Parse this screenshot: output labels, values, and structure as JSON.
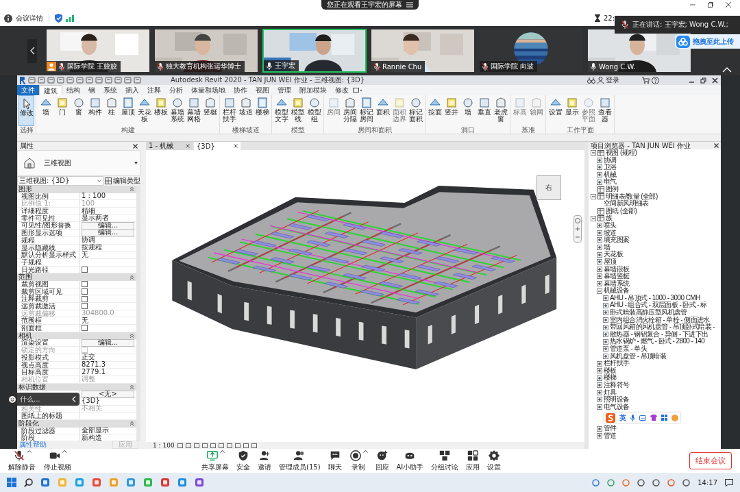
{
  "meeting": {
    "banner": "您正在观看王宇宏的屏幕",
    "details": "会议详情",
    "timer": "22:",
    "speaking": "正在讲话:  王宇宏; Wong C.W.;",
    "upload": "拖拽至此上传"
  },
  "participants": [
    {
      "name": "国际学院 王姣姣",
      "muted": true,
      "speaking": false,
      "host": true,
      "kind": "video"
    },
    {
      "name": "独大教育机构张运华博士",
      "muted": true,
      "speaking": false,
      "host": false,
      "kind": "video"
    },
    {
      "name": "王宇宏",
      "muted": false,
      "speaking": true,
      "host": false,
      "kind": "video"
    },
    {
      "name": "Rannie Chu",
      "muted": true,
      "speaking": false,
      "host": false,
      "kind": "video"
    },
    {
      "name": "国际学院 向波",
      "muted": true,
      "speaking": false,
      "host": false,
      "kind": "avatar"
    },
    {
      "name": "Wong C.W.",
      "muted": false,
      "speaking": false,
      "host": false,
      "kind": "video"
    }
  ],
  "revit": {
    "title": "Autodesk Revit 2020 - TAN JUN WEI 作业 - 三维视图: {3D}",
    "login": "登录",
    "tabs": [
      {
        "label": "文件",
        "kind": "file",
        "selected": false
      },
      {
        "label": "建筑",
        "kind": "tab",
        "selected": true
      },
      {
        "label": "结构",
        "kind": "tab",
        "selected": false
      },
      {
        "label": "钢",
        "kind": "tab",
        "selected": false
      },
      {
        "label": "系统",
        "kind": "tab",
        "selected": false
      },
      {
        "label": "插入",
        "kind": "tab",
        "selected": false
      },
      {
        "label": "注释",
        "kind": "tab",
        "selected": false
      },
      {
        "label": "分析",
        "kind": "tab",
        "selected": false
      },
      {
        "label": "体量和场地",
        "kind": "tab",
        "selected": false
      },
      {
        "label": "协作",
        "kind": "tab",
        "selected": false
      },
      {
        "label": "视图",
        "kind": "tab",
        "selected": false
      },
      {
        "label": "管理",
        "kind": "tab",
        "selected": false
      },
      {
        "label": "附加模块",
        "kind": "tab",
        "selected": false
      },
      {
        "label": "修改",
        "kind": "tab",
        "selected": false
      }
    ],
    "panels": [
      {
        "label": "选择",
        "tools": [
          {
            "label": "修改",
            "selected": true,
            "disabled": false
          }
        ]
      },
      {
        "label": "构建",
        "tools": [
          {
            "label": "墙",
            "selected": false,
            "disabled": false
          },
          {
            "label": "门",
            "selected": false,
            "disabled": false
          },
          {
            "label": "窗",
            "selected": false,
            "disabled": false
          },
          {
            "label": "构件",
            "selected": false,
            "disabled": false
          },
          {
            "label": "柱",
            "selected": false,
            "disabled": false
          },
          {
            "label": "屋顶",
            "selected": false,
            "disabled": false
          },
          {
            "label": "天花板",
            "selected": false,
            "disabled": false
          },
          {
            "label": "楼板",
            "selected": false,
            "disabled": false
          },
          {
            "label": "幕墙系统",
            "selected": false,
            "disabled": false
          },
          {
            "label": "幕墙网格",
            "selected": false,
            "disabled": false
          },
          {
            "label": "竖梃",
            "selected": false,
            "disabled": false
          }
        ]
      },
      {
        "label": "楼梯坡道",
        "tools": [
          {
            "label": "栏杆扶手",
            "selected": false,
            "disabled": false
          },
          {
            "label": "坡道",
            "selected": false,
            "disabled": false
          },
          {
            "label": "楼梯",
            "selected": false,
            "disabled": false
          }
        ]
      },
      {
        "label": "模型",
        "tools": [
          {
            "label": "模型文字",
            "selected": false,
            "disabled": false
          },
          {
            "label": "模型线",
            "selected": false,
            "disabled": false
          },
          {
            "label": "模型组",
            "selected": false,
            "disabled": false
          }
        ]
      },
      {
        "label": "房间和面积",
        "tools": [
          {
            "label": "房间",
            "selected": false,
            "disabled": true
          },
          {
            "label": "房间分隔",
            "selected": false,
            "disabled": false
          },
          {
            "label": "标记房间",
            "selected": false,
            "disabled": false
          },
          {
            "label": "面积",
            "selected": false,
            "disabled": false
          },
          {
            "label": "面积边界",
            "selected": false,
            "disabled": true
          },
          {
            "label": "标记面积",
            "selected": false,
            "disabled": false
          }
        ]
      },
      {
        "label": "洞口",
        "tools": [
          {
            "label": "按面",
            "selected": false,
            "disabled": false
          },
          {
            "label": "竖井",
            "selected": false,
            "disabled": false
          },
          {
            "label": "墙",
            "selected": false,
            "disabled": false
          },
          {
            "label": "垂直",
            "selected": false,
            "disabled": false
          },
          {
            "label": "老虎窗",
            "selected": false,
            "disabled": false
          }
        ]
      },
      {
        "label": "基准",
        "tools": [
          {
            "label": "标高",
            "selected": false,
            "disabled": true
          },
          {
            "label": "轴网",
            "selected": false,
            "disabled": true
          }
        ]
      },
      {
        "label": "工作平面",
        "tools": [
          {
            "label": "设置",
            "selected": false,
            "disabled": false
          },
          {
            "label": "显示",
            "selected": false,
            "disabled": false
          },
          {
            "label": "参照平面",
            "selected": false,
            "disabled": true
          },
          {
            "label": "查看器",
            "selected": false,
            "disabled": false
          }
        ]
      }
    ]
  },
  "properties": {
    "title": "属性",
    "type_name": "三维视图",
    "instance": "三维视图: {3D}",
    "edit_type": "编辑类型",
    "help": "属性帮助",
    "apply": "应用",
    "overlay": "什么...",
    "groups": [
      {
        "name": "图形",
        "rows": [
          {
            "label": "视图比例",
            "kind": "text",
            "value": "1 : 100",
            "disabled": false
          },
          {
            "label": "比例值 1:",
            "kind": "text",
            "value": "100",
            "disabled": true
          },
          {
            "label": "详细程度",
            "kind": "text",
            "value": "精细",
            "disabled": false
          },
          {
            "label": "零件可见性",
            "kind": "text",
            "value": "显示两者",
            "disabled": false
          },
          {
            "label": "可见性/图形替换",
            "kind": "button",
            "value": "编辑...",
            "disabled": false
          },
          {
            "label": "图形显示选项",
            "kind": "button",
            "value": "编辑...",
            "disabled": false
          },
          {
            "label": "规程",
            "kind": "text",
            "value": "协调",
            "disabled": false
          },
          {
            "label": "显示隐藏线",
            "kind": "text",
            "value": "按规程",
            "disabled": false
          },
          {
            "label": "默认分析显示样式",
            "kind": "text",
            "value": "无",
            "disabled": false
          },
          {
            "label": "子规程",
            "kind": "text",
            "disabled": false
          },
          {
            "label": "日光路径",
            "kind": "checkbox",
            "checked": false,
            "disabled": false
          }
        ]
      },
      {
        "name": "范围",
        "rows": [
          {
            "label": "裁剪视图",
            "kind": "checkbox",
            "checked": false,
            "disabled": false
          },
          {
            "label": "裁剪区域可见",
            "kind": "checkbox",
            "checked": false,
            "disabled": false
          },
          {
            "label": "注释裁剪",
            "kind": "checkbox",
            "checked": false,
            "disabled": false
          },
          {
            "label": "远剪裁激活",
            "kind": "checkbox",
            "checked": false,
            "disabled": false
          },
          {
            "label": "远剪裁偏移",
            "kind": "text",
            "value": "304800.0",
            "disabled": true
          },
          {
            "label": "范围框",
            "kind": "text",
            "value": "无",
            "disabled": false
          },
          {
            "label": "剖面框",
            "kind": "checkbox",
            "checked": false,
            "disabled": false
          }
        ]
      },
      {
        "name": "相机",
        "rows": [
          {
            "label": "渲染设置",
            "kind": "button",
            "value": "编辑...",
            "disabled": false
          },
          {
            "label": "锁定的方向",
            "kind": "checkbox",
            "checked": false,
            "disabled": true
          },
          {
            "label": "投影模式",
            "kind": "text",
            "value": "正交",
            "disabled": false
          },
          {
            "label": "视点高度",
            "kind": "text",
            "value": "8271.3",
            "disabled": false
          },
          {
            "label": "目标高度",
            "kind": "text",
            "value": "2779.1",
            "disabled": false
          },
          {
            "label": "相机位置",
            "kind": "text",
            "value": "调整",
            "disabled": true
          }
        ]
      },
      {
        "name": "标识数据",
        "rows": [
          {
            "kind": "button",
            "value": "<无>",
            "disabled": false
          },
          {
            "kind": "text",
            "value": "{3D}",
            "disabled": false
          },
          {
            "label": "相关性",
            "kind": "text",
            "value": "不相关",
            "disabled": true
          },
          {
            "label": "图纸上的标题",
            "kind": "text",
            "disabled": false
          }
        ]
      },
      {
        "name": "阶段化",
        "rows": [
          {
            "label": "阶段过滤器",
            "kind": "text",
            "value": "全部显示",
            "disabled": false
          },
          {
            "label": "阶段",
            "kind": "text",
            "value": "新构造",
            "disabled": false
          }
        ]
      }
    ]
  },
  "view": {
    "tabs": [
      {
        "label": "1 - 机械",
        "selected": false
      },
      {
        "label": "{3D}",
        "selected": true
      }
    ],
    "cube": "右",
    "scale": "1 : 100"
  },
  "browser": {
    "title": "项目浏览器 - TAN JUN WEI 作业",
    "tree": [
      {
        "label": "视图 (规程)",
        "expanded": true,
        "children": [
          {
            "label": "协调",
            "expanded": false
          },
          {
            "label": "卫浴",
            "expanded": false
          },
          {
            "label": "机械",
            "expanded": false
          },
          {
            "label": "电气",
            "expanded": false
          }
        ]
      },
      {
        "label": "图例"
      },
      {
        "label": "明细表/数量 (全部)",
        "expanded": true,
        "children": [
          {
            "label": "空间新风明细表"
          }
        ]
      },
      {
        "label": "图纸 (全部)"
      },
      {
        "label": "族",
        "expanded": true,
        "children": [
          {
            "label": "喷头",
            "expanded": false
          },
          {
            "label": "坡道",
            "expanded": false
          },
          {
            "label": "填充图案",
            "expanded": false
          },
          {
            "label": "墙",
            "expanded": false
          },
          {
            "label": "天花板",
            "expanded": false
          },
          {
            "label": "屋顶",
            "expanded": false
          },
          {
            "label": "幕墙嵌板",
            "expanded": false
          },
          {
            "label": "幕墙竖梃",
            "expanded": false
          },
          {
            "label": "幕墙系统",
            "expanded": false
          },
          {
            "label": "机械设备",
            "expanded": true,
            "children": [
              {
                "label": "AHU - 吊顶式 - 1000 - 3000 CMH",
                "expanded": false
              },
              {
                "label": "AHU - 组合式 - 双层面板 - 卧式 - 标",
                "expanded": false
              },
              {
                "label": "卧式暗装高静压型风机盘管",
                "expanded": false
              },
              {
                "label": "室内组合消火栓箱 - 单栓 - 侧面进水",
                "expanded": false
              },
              {
                "label": "带回风箱的风机盘管 - 吊顶卧式暗装 -",
                "expanded": false
              },
              {
                "label": "散热器 - 钢铝复合 - 异侧 - 下进下出",
                "expanded": false
              },
              {
                "label": "热水锅炉 - 燃气 - 卧式 - 2800 - 140",
                "expanded": false
              },
              {
                "label": "管道泵 - 单头",
                "expanded": false
              },
              {
                "label": "风机盘管 - 吊顶暗装",
                "expanded": false
              }
            ]
          },
          {
            "label": "栏杆扶手",
            "expanded": false
          },
          {
            "label": "楼板",
            "expanded": false
          },
          {
            "label": "楼梯",
            "expanded": false
          },
          {
            "label": "注释符号",
            "expanded": false
          },
          {
            "label": "灯具",
            "expanded": false
          },
          {
            "label": "照明设备",
            "expanded": false
          },
          {
            "label": "电气设备",
            "expanded": false
          },
          {
            "label": "管件",
            "expanded": false
          },
          {
            "label": "管道",
            "expanded": false
          }
        ]
      }
    ]
  },
  "ime": {
    "label": "英"
  },
  "toolbar": {
    "left_buttons": [
      {
        "label": "解除静音",
        "kind": "mic-off",
        "caret": true
      },
      {
        "label": "停止视频",
        "kind": "video",
        "caret": true
      }
    ],
    "center_buttons": [
      {
        "label": "共享屏幕",
        "kind": "share",
        "caret": true
      },
      {
        "label": "安全",
        "kind": "shield",
        "caret": false
      },
      {
        "label": "邀请",
        "kind": "invite",
        "caret": false
      },
      {
        "label": "管理成员(15)",
        "kind": "members",
        "caret": false
      },
      {
        "label": "聊天",
        "kind": "chat",
        "caret": false
      },
      {
        "label": "录制",
        "kind": "record",
        "caret": true
      },
      {
        "label": "回应",
        "kind": "react",
        "caret": false
      },
      {
        "label": "AI小助手",
        "kind": "ai",
        "caret": false
      },
      {
        "label": "分组讨论",
        "kind": "breakout",
        "caret": false
      },
      {
        "label": "应用",
        "kind": "apps",
        "caret": false
      },
      {
        "label": "设置",
        "kind": "settings",
        "caret": false
      }
    ],
    "end": "结束会议"
  },
  "taskbar": {
    "time": "14:17"
  }
}
